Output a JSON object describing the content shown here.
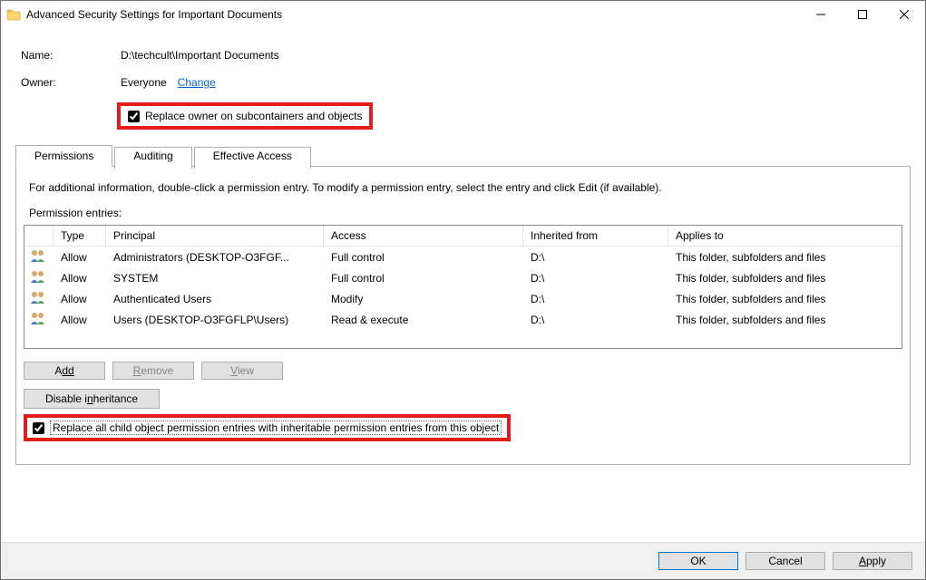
{
  "window": {
    "title": "Advanced Security Settings for Important Documents"
  },
  "name_label": "Name:",
  "name_value": "D:\\techcult\\Important Documents",
  "owner_label": "Owner:",
  "owner_value": "Everyone",
  "change_link": "Change",
  "replace_owner_label": "Replace owner on subcontainers and objects",
  "replace_owner_checked": true,
  "tabs": {
    "permissions": "Permissions",
    "auditing": "Auditing",
    "effective": "Effective Access"
  },
  "info_text": "For additional information, double-click a permission entry. To modify a permission entry, select the entry and click Edit (if available).",
  "entries_label": "Permission entries:",
  "columns": {
    "type": "Type",
    "principal": "Principal",
    "access": "Access",
    "inherited": "Inherited from",
    "applies": "Applies to"
  },
  "rows": [
    {
      "type": "Allow",
      "principal": "Administrators (DESKTOP-O3FGF...",
      "access": "Full control",
      "inherited": "D:\\",
      "applies": "This folder, subfolders and files"
    },
    {
      "type": "Allow",
      "principal": "SYSTEM",
      "access": "Full control",
      "inherited": "D:\\",
      "applies": "This folder, subfolders and files"
    },
    {
      "type": "Allow",
      "principal": "Authenticated Users",
      "access": "Modify",
      "inherited": "D:\\",
      "applies": "This folder, subfolders and files"
    },
    {
      "type": "Allow",
      "principal": "Users (DESKTOP-O3FGFLP\\Users)",
      "access": "Read & execute",
      "inherited": "D:\\",
      "applies": "This folder, subfolders and files"
    }
  ],
  "buttons": {
    "add": "Add",
    "remove": "Remove",
    "view": "View",
    "disable_inh": "Disable inheritance",
    "ok": "OK",
    "cancel": "Cancel",
    "apply": "Apply"
  },
  "replace_child_label": "Replace all child object permission entries with inheritable permission entries from this object",
  "replace_child_checked": true
}
